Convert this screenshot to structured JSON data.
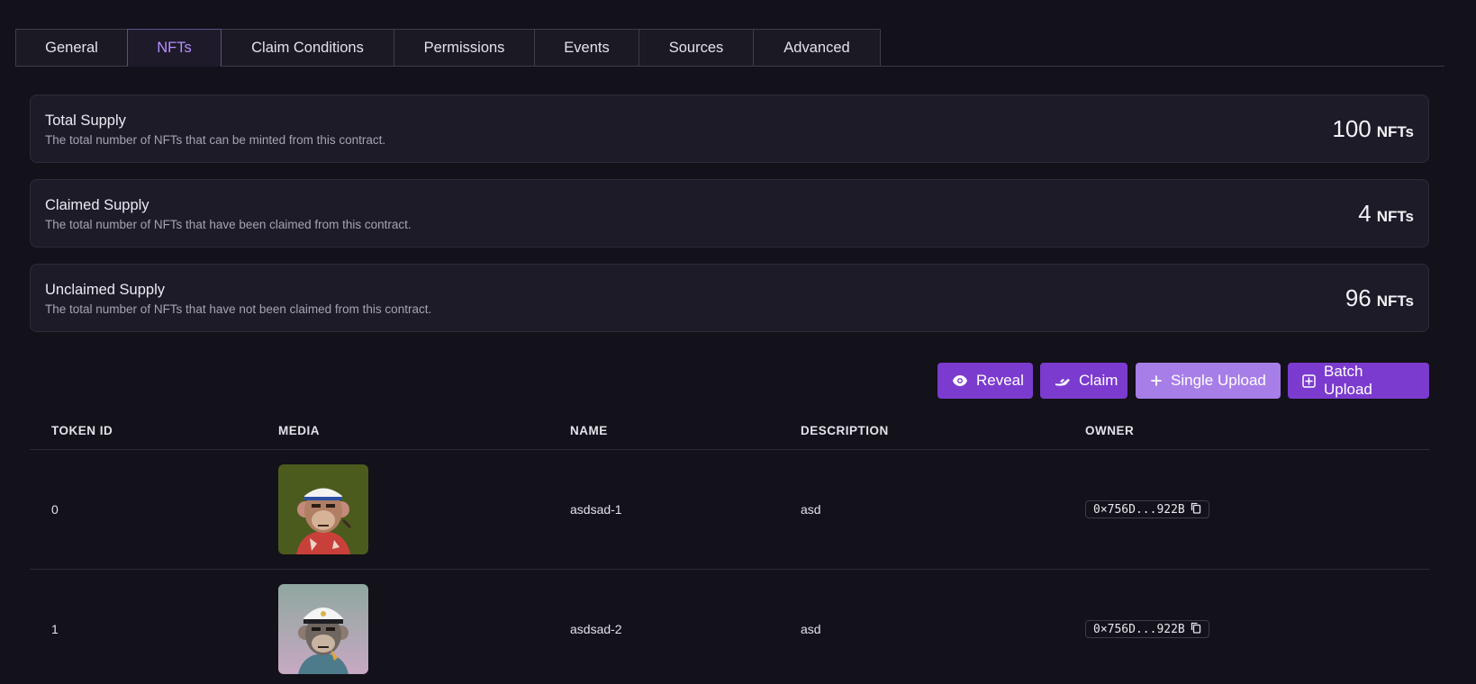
{
  "tabs": [
    {
      "label": "General"
    },
    {
      "label": "NFTs"
    },
    {
      "label": "Claim Conditions"
    },
    {
      "label": "Permissions"
    },
    {
      "label": "Events"
    },
    {
      "label": "Sources"
    },
    {
      "label": "Advanced"
    }
  ],
  "stats": [
    {
      "title": "Total Supply",
      "description": "The total number of NFTs that can be minted from this contract.",
      "value": "100",
      "unit": "NFTs"
    },
    {
      "title": "Claimed Supply",
      "description": "The total number of NFTs that have been claimed from this contract.",
      "value": "4",
      "unit": "NFTs"
    },
    {
      "title": "Unclaimed Supply",
      "description": "The total number of NFTs that have not been claimed from this contract.",
      "value": "96",
      "unit": "NFTs"
    }
  ],
  "actions": {
    "reveal": "Reveal",
    "claim": "Claim",
    "single_upload": "Single Upload",
    "batch_upload": "Batch Upload"
  },
  "table": {
    "headers": {
      "token_id": "TOKEN ID",
      "media": "MEDIA",
      "name": "NAME",
      "description": "DESCRIPTION",
      "owner": "OWNER"
    },
    "rows": [
      {
        "token_id": "0",
        "name": "asdsad-1",
        "description": "asd",
        "owner": "0×756D...922B"
      },
      {
        "token_id": "1",
        "name": "asdsad-2",
        "description": "asd",
        "owner": "0×756D...922B"
      }
    ]
  },
  "colors": {
    "accent": "#7b3bcf",
    "accent_light": "#a77ee8",
    "active_tab": "#b690ff",
    "background": "#131119"
  },
  "icons": [
    "eye-icon",
    "ship-icon",
    "plus-icon",
    "plus-square-icon",
    "copy-icon"
  ]
}
